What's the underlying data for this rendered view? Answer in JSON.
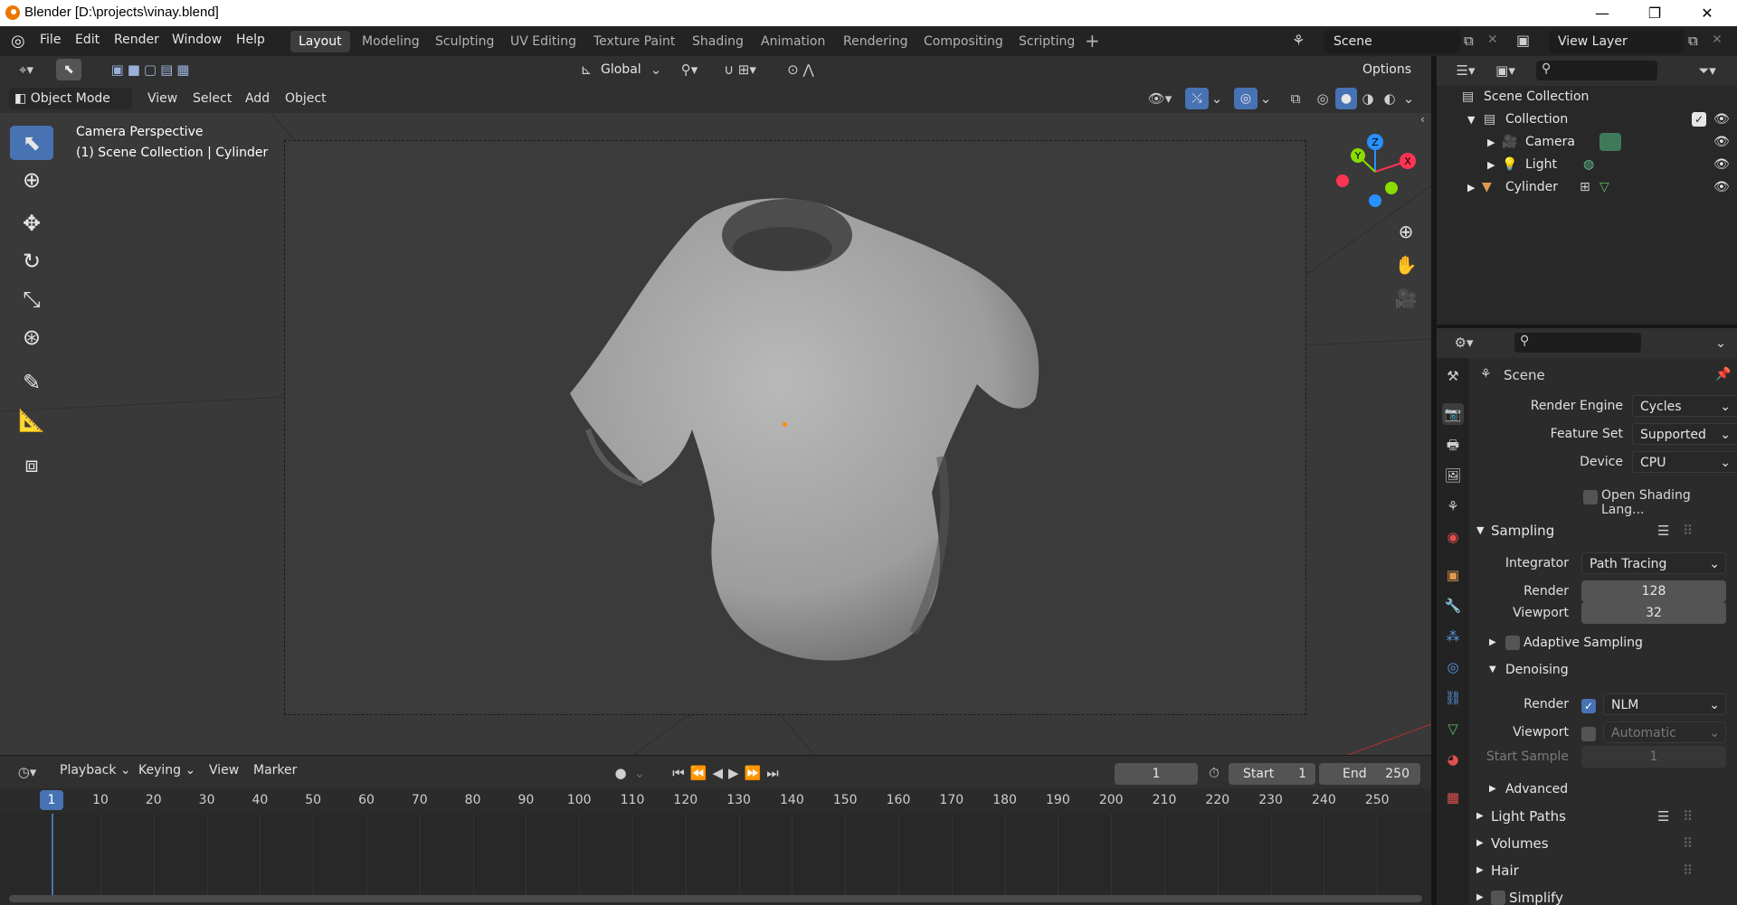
{
  "window": {
    "title": "Blender [D:\\projects\\vinay.blend]",
    "minimize": "—",
    "maximize": "❐",
    "close": "✕"
  },
  "menu": [
    "File",
    "Edit",
    "Render",
    "Window",
    "Help"
  ],
  "workspaces": [
    "Layout",
    "Modeling",
    "Sculpting",
    "UV Editing",
    "Texture Paint",
    "Shading",
    "Animation",
    "Rendering",
    "Compositing",
    "Scripting"
  ],
  "active_workspace": "Layout",
  "scene_field": "Scene",
  "view_layer_field": "View Layer",
  "viewport_header": {
    "transform_orientation": "Global",
    "options": "Options",
    "mode": "Object Mode",
    "menus": [
      "View",
      "Select",
      "Add",
      "Object"
    ]
  },
  "viewport": {
    "camera_label": "Camera Perspective",
    "context_label": "(1) Scene Collection | Cylinder",
    "gizmo_axes": {
      "x": "X",
      "y": "Y",
      "z": "Z"
    }
  },
  "timeline": {
    "menus": [
      "Playback",
      "Keying",
      "View",
      "Marker"
    ],
    "current_frame": "1",
    "start_label": "Start",
    "start_value": "1",
    "end_label": "End",
    "end_value": "250",
    "ticks": [
      "1",
      "10",
      "20",
      "30",
      "40",
      "50",
      "60",
      "70",
      "80",
      "90",
      "100",
      "110",
      "120",
      "130",
      "140",
      "150",
      "160",
      "170",
      "180",
      "190",
      "200",
      "210",
      "220",
      "230",
      "240",
      "250"
    ]
  },
  "outliner": {
    "root": "Scene Collection",
    "collection": "Collection",
    "items": [
      "Camera",
      "Light"
    ],
    "cylinder": "Cylinder"
  },
  "properties": {
    "context": "Scene",
    "render_engine_label": "Render Engine",
    "render_engine": "Cycles",
    "feature_set_label": "Feature Set",
    "feature_set": "Supported",
    "device_label": "Device",
    "device": "CPU",
    "osl_label": "Open Shading Lang...",
    "sampling": "Sampling",
    "integrator_label": "Integrator",
    "integrator": "Path Tracing",
    "render_label": "Render",
    "render_samples": "128",
    "viewport_label": "Viewport",
    "viewport_samples": "32",
    "adaptive_sampling": "Adaptive Sampling",
    "denoising": "Denoising",
    "denoise_render_label": "Render",
    "denoise_render": "NLM",
    "denoise_viewport_label": "Viewport",
    "denoise_viewport": "Automatic",
    "start_sample_label": "Start Sample",
    "start_sample": "1",
    "advanced": "Advanced",
    "light_paths": "Light Paths",
    "volumes": "Volumes",
    "hair": "Hair",
    "simplify": "Simplify"
  },
  "colors": {
    "accent": "#4772b3",
    "axis_x": "#ff3352",
    "axis_y": "#8bdc00",
    "axis_z": "#2890ff"
  }
}
